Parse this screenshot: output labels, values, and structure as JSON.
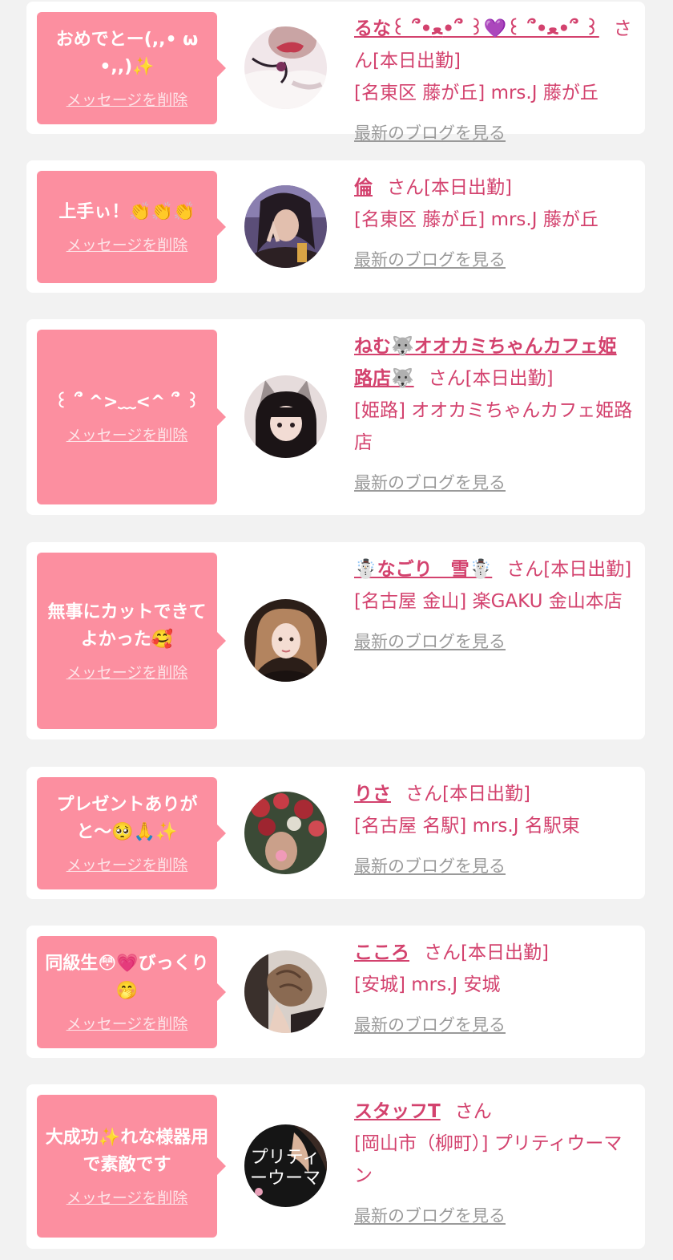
{
  "cards": [
    {
      "message": "おめでとー(,,• ω•,,)✨",
      "delete_label": "メッセージを削除",
      "name": "るな꒰ ՞•ﻌ•՞ ꒱💜꒰ ՞•ﻌ•՞ ꒱",
      "suffix": "さん[本日出勤]",
      "shop": "[名東区 藤が丘] mrs.J 藤が丘",
      "blog_label": "最新のブログを見る",
      "avatar_colors": [
        "#f4e6ea",
        "#8b3b4a"
      ]
    },
    {
      "message": "上手ぃ！👏👏👏",
      "delete_label": "メッセージを削除",
      "name": "倫",
      "suffix": "さん[本日出勤]",
      "shop": "[名東区 藤が丘] mrs.J 藤が丘",
      "blog_label": "最新のブログを見る",
      "avatar_colors": [
        "#6b5a8a",
        "#2d2436"
      ]
    },
    {
      "message": "꒰ ՞ ^>﹏<^ ՞ ꒱",
      "delete_label": "メッセージを削除",
      "name": "ねむ🐺オオカミちゃんカフェ姫路店🐺",
      "suffix": "さん[本日出勤]",
      "shop": "[姫路] オオカミちゃんカフェ姫路店",
      "blog_label": "最新のブログを見る",
      "avatar_colors": [
        "#e9dede",
        "#3a2a2a"
      ]
    },
    {
      "message": "無事にカットできてよかった🥰",
      "delete_label": "メッセージを削除",
      "name": "☃️なごり　雪☃️",
      "suffix": "さん[本日出勤]",
      "shop": "[名古屋 金山] 楽GAKU 金山本店",
      "blog_label": "最新のブログを見る",
      "avatar_colors": [
        "#c89a7a",
        "#2a1c16"
      ]
    },
    {
      "message": "プレゼントありがと〜🥺🙏✨",
      "delete_label": "メッセージを削除",
      "name": "りさ",
      "suffix": "さん[本日出勤]",
      "shop": "[名古屋 名駅] mrs.J 名駅東",
      "blog_label": "最新のブログを見る",
      "avatar_colors": [
        "#b8323a",
        "#3a5a3a"
      ]
    },
    {
      "message": "同級生😳💗びっくり🤭",
      "delete_label": "メッセージを削除",
      "name": "こころ",
      "suffix": "さん[本日出勤]",
      "shop": "[安城] mrs.J 安城",
      "blog_label": "最新のブログを見る",
      "avatar_colors": [
        "#d9cfc8",
        "#4a3a32"
      ]
    },
    {
      "message": "大成功✨れな様器用で素敵です",
      "delete_label": "メッセージを削除",
      "name": "スタッフT",
      "suffix": "さん",
      "shop": "[岡山市（柳町）] プリティウーマン",
      "blog_label": "最新のブログを見る",
      "avatar_colors": [
        "#1a1a1a",
        "#e8a0b8"
      ],
      "avatar_text": "プリティーウーマ"
    }
  ]
}
